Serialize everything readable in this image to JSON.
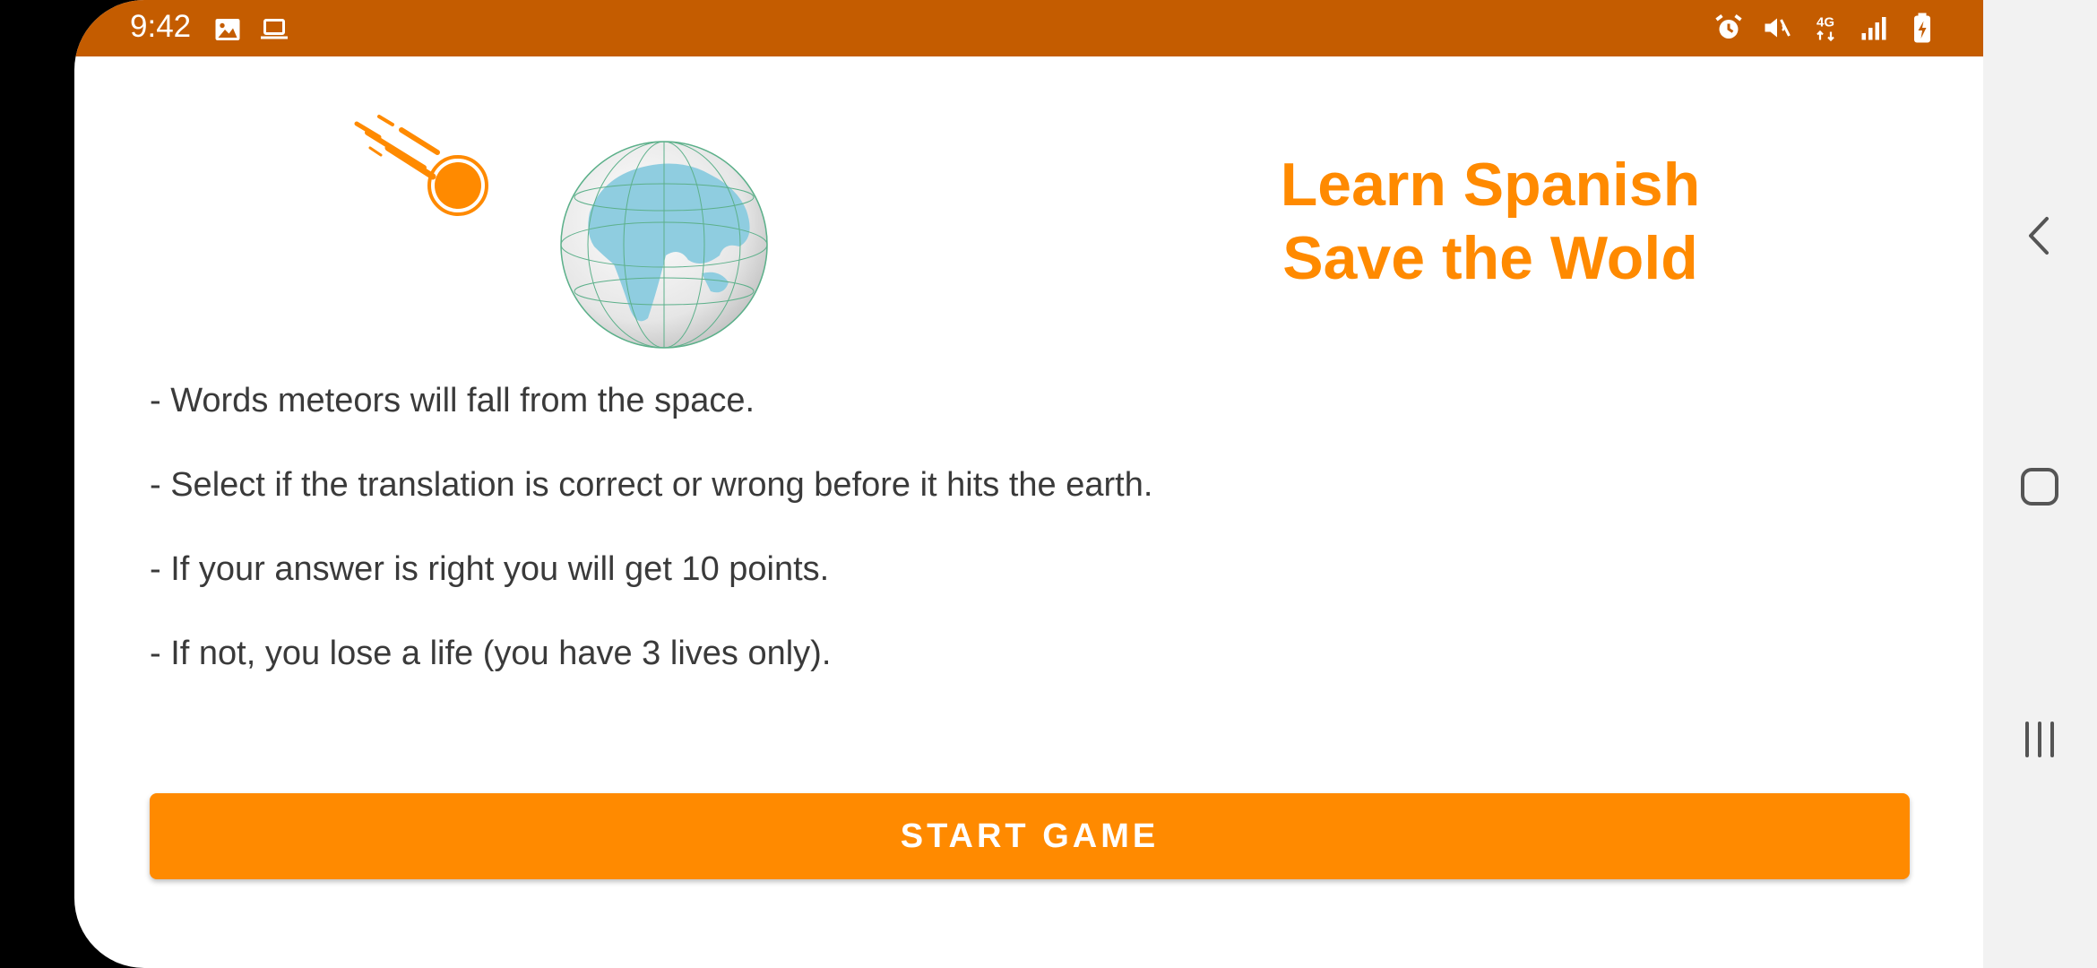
{
  "status_bar": {
    "time": "9:42",
    "left_icons": [
      "image-icon",
      "laptop-icon"
    ],
    "right_icons": [
      "alarm-icon",
      "mute-icon",
      "4g-icon",
      "signal-icon",
      "battery-charging-icon"
    ],
    "network_label": "4G",
    "background_color": "#c45c00"
  },
  "header": {
    "title_line1": "Learn Spanish",
    "title_line2": "Save the Wold",
    "title_color": "#ff8a00"
  },
  "hero": {
    "meteor_icon": "meteor-icon",
    "globe_icon": "globe-icon"
  },
  "rules": [
    "- Words meteors will fall from the space.",
    "- Select if the translation is correct or wrong before it hits the earth.",
    "- If your answer is right you will get 10 points.",
    "- If not, you lose a life (you have 3 lives only)."
  ],
  "actions": {
    "start_label": "START GAME",
    "button_color": "#ff8a00"
  },
  "nav_bar": {
    "buttons": [
      "back-icon",
      "home-icon",
      "recents-icon"
    ]
  }
}
